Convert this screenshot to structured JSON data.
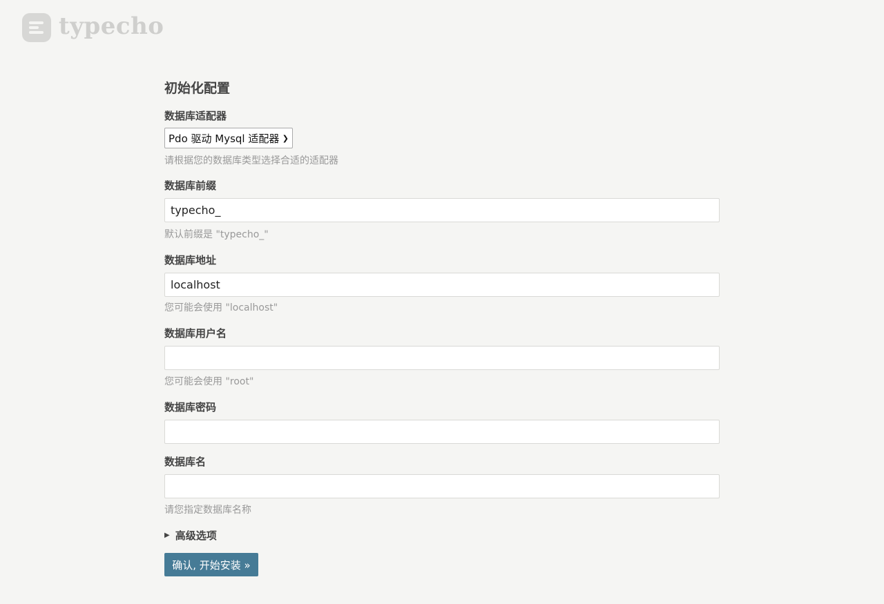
{
  "brand": {
    "name": "typecho"
  },
  "form": {
    "title": "初始化配置",
    "adapter": {
      "label": "数据库适配器",
      "selected": "Pdo 驱动 Mysql 适配器",
      "description": "请根据您的数据库类型选择合适的适配器"
    },
    "prefix": {
      "label": "数据库前缀",
      "value": "typecho_",
      "description": "默认前缀是 \"typecho_\""
    },
    "host": {
      "label": "数据库地址",
      "value": "localhost",
      "description": "您可能会使用 \"localhost\""
    },
    "user": {
      "label": "数据库用户名",
      "value": "",
      "description": "您可能会使用 \"root\""
    },
    "password": {
      "label": "数据库密码",
      "value": ""
    },
    "name": {
      "label": "数据库名",
      "value": "",
      "description": "请您指定数据库名称"
    },
    "advanced_label": "高级选项",
    "submit_label": "确认, 开始安装 »"
  },
  "colors": {
    "background": "#f5f5f3",
    "button": "#467b96",
    "description_text": "#999999"
  },
  "icons": {
    "logo": "typecho-logo-icon",
    "disclosure": "triangle-right-icon",
    "select": "chevron-down-icon"
  }
}
